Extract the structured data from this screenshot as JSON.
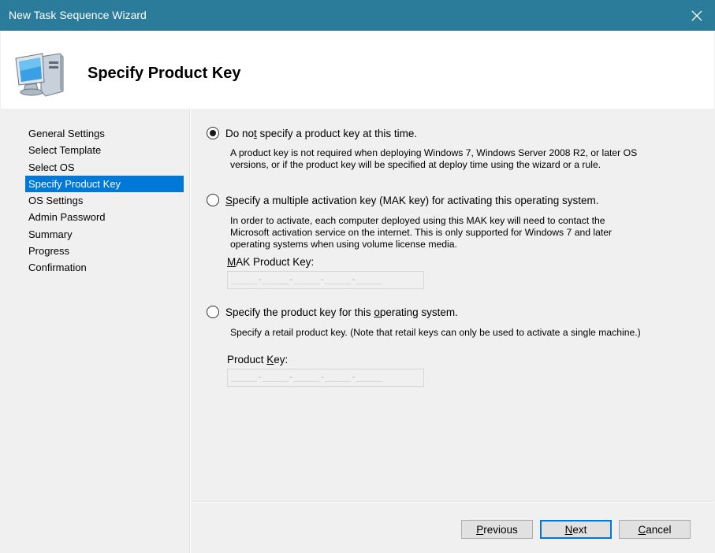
{
  "window": {
    "title": "New Task Sequence Wizard",
    "close_glyph": "✕"
  },
  "header": {
    "icon": "computer-monitor-icon",
    "heading": "Specify Product Key"
  },
  "nav": {
    "items": [
      {
        "label": "General Settings"
      },
      {
        "label": "Select Template"
      },
      {
        "label": "Select OS"
      },
      {
        "label": "Specify Product Key",
        "active": true
      },
      {
        "label": "OS Settings"
      },
      {
        "label": "Admin Password"
      },
      {
        "label": "Summary"
      },
      {
        "label": "Progress"
      },
      {
        "label": "Confirmation"
      }
    ]
  },
  "options": {
    "no_key": {
      "label_pre": "Do no",
      "label_access": "t",
      "label_post": " specify a product key at this time.",
      "checked": true,
      "description_line1": "A product key is not required when deploying Windows 7, Windows Server 2008 R2, or later OS",
      "description_line2": "versions, or if the product key will be specified at deploy time using the wizard or a rule."
    },
    "mak": {
      "label_access": "S",
      "label_post": "pecify a multiple activation key (MAK key) for activating this operating system.",
      "checked": false,
      "description_line1": "In order to activate, each computer deployed using this MAK key will need to contact the",
      "description_line2": "Microsoft activation service on the internet.  This is only supported for Windows 7 and later",
      "description_line3": "operating systems when using volume license media.",
      "field_label_access": "M",
      "field_label_post": "AK Product Key:",
      "field_mask": "_____-_____-_____-_____-_____"
    },
    "retail": {
      "label_pre": "Specify the product key for this ",
      "label_access": "o",
      "label_post": "perating system.",
      "checked": false,
      "description": "Specify a retail product key.  (Note that retail keys can only be used to activate a single machine.)",
      "field_label_pre": "Product ",
      "field_label_access": "K",
      "field_label_post": "ey:",
      "field_mask": "_____-_____-_____-_____-_____"
    }
  },
  "buttons": {
    "previous": {
      "access": "P",
      "rest": "revious"
    },
    "next": {
      "access": "N",
      "rest": "ext"
    },
    "cancel": {
      "access": "C",
      "rest": "ancel"
    }
  }
}
